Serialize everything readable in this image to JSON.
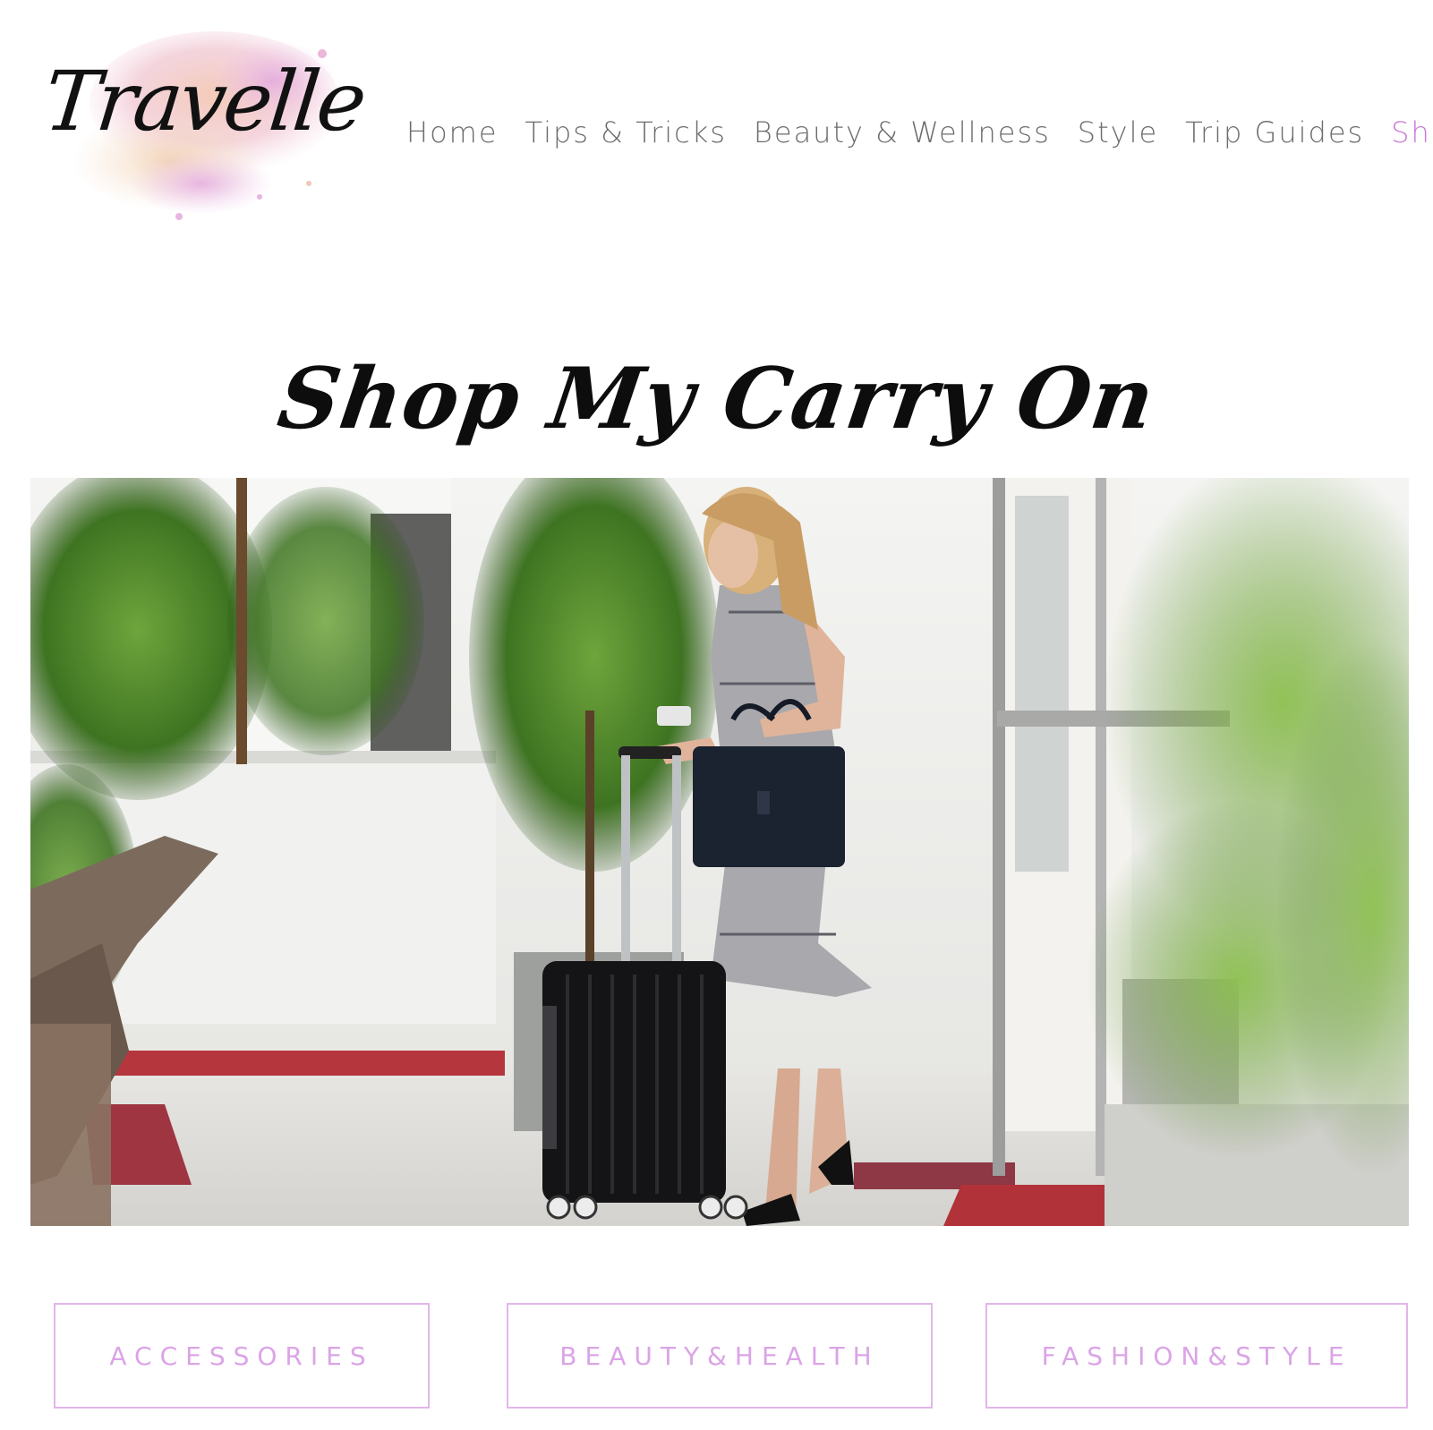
{
  "site": {
    "logo_text": "Travelle",
    "accent_color": "#c77bd6",
    "button_color": "#dba4e6"
  },
  "nav": {
    "items": [
      {
        "label": "Home"
      },
      {
        "label": "Tips & Tricks"
      },
      {
        "label": "Beauty & Wellness"
      },
      {
        "label": "Style"
      },
      {
        "label": "Trip Guides"
      },
      {
        "label": "Shop"
      }
    ],
    "active": "Shop"
  },
  "main": {
    "title": "Shop My Carry On"
  },
  "categories": [
    {
      "label": "ACCESSORIES"
    },
    {
      "label": "BEAUTY&HEALTH"
    },
    {
      "label": "FASHION&STYLE"
    }
  ]
}
